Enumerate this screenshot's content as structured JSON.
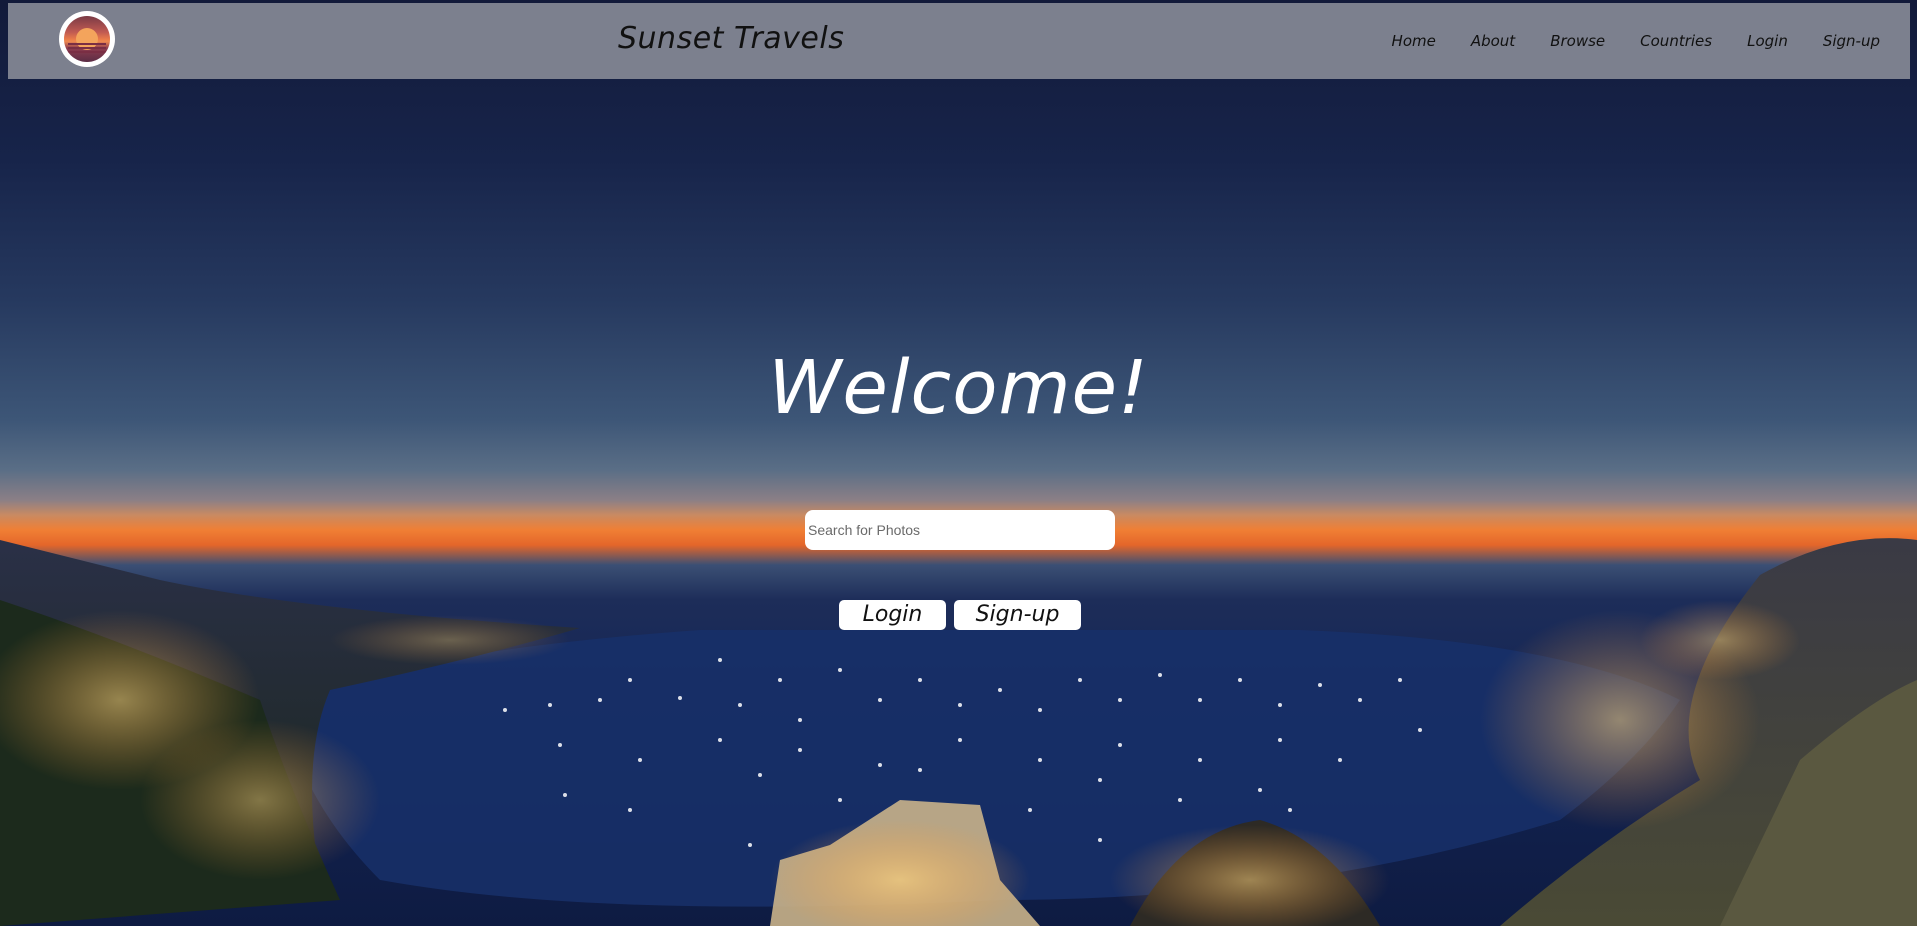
{
  "header": {
    "logo_name": "sunset-logo",
    "title": "Sunset Travels",
    "nav": [
      "Home",
      "About",
      "Browse",
      "Countries",
      "Login",
      "Sign-up"
    ]
  },
  "hero": {
    "heading": "Welcome!",
    "search": {
      "placeholder": "Search for Photos",
      "value": ""
    },
    "buttons": {
      "login": "Login",
      "signup": "Sign-up"
    }
  },
  "colors": {
    "navbar": "#7c808e",
    "sky_top": "#121a3a",
    "sunset_glow": "#f07f34",
    "sea": "#142554"
  }
}
